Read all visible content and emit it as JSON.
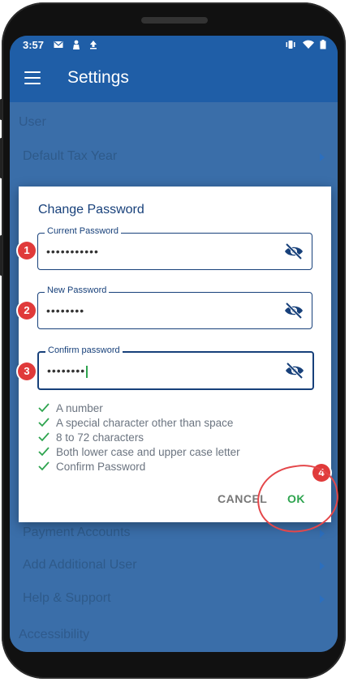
{
  "status_bar": {
    "time": "3:57"
  },
  "app_bar": {
    "title": "Settings"
  },
  "settings": {
    "section_user": "User",
    "default_tax_year": "Default Tax Year",
    "payment_accounts": "Payment Accounts",
    "add_additional_user": "Add Additional User",
    "help_support": "Help & Support",
    "section_accessibility": "Accessibility"
  },
  "dialog": {
    "title": "Change Password",
    "current_password": {
      "label": "Current Password",
      "value": "•••••••••••"
    },
    "new_password": {
      "label": "New Password",
      "value": "••••••••"
    },
    "confirm_password": {
      "label": "Confirm password",
      "value": "••••••••"
    },
    "requirements": [
      "A number",
      "A special character other than space",
      "8 to 72 characters",
      "Both lower case and upper case letter",
      "Confirm Password"
    ],
    "cancel_label": "CANCEL",
    "ok_label": "OK"
  },
  "annotations": [
    "1",
    "2",
    "3",
    "4"
  ],
  "colors": {
    "primary": "#1f5ea7",
    "dialog_text": "#17407a",
    "success": "#2ea44f",
    "annotation": "#e03a3a"
  }
}
